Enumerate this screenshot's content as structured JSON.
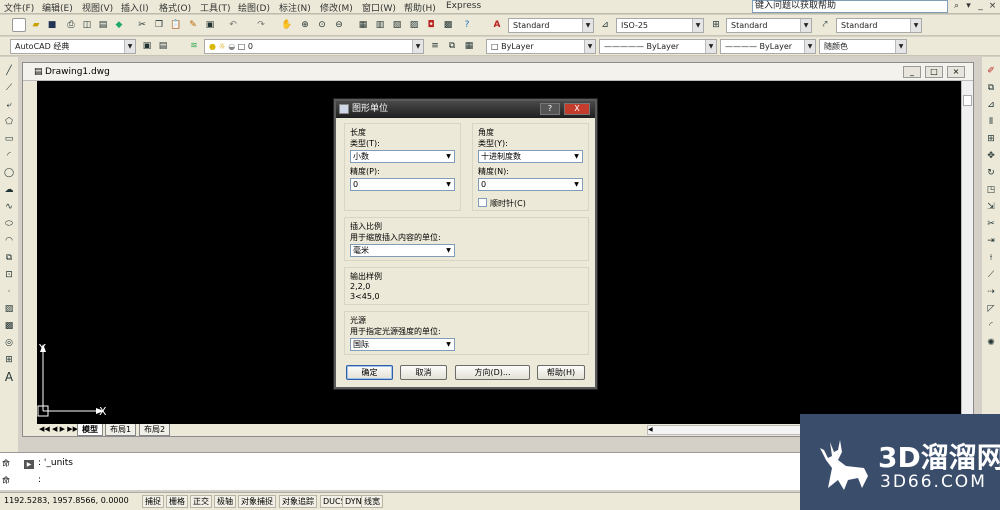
{
  "menu": {
    "items": [
      "文件(F)",
      "编辑(E)",
      "视图(V)",
      "插入(I)",
      "格式(O)",
      "工具(T)",
      "绘图(D)",
      "标注(N)",
      "修改(M)",
      "窗口(W)",
      "帮助(H)",
      "Express"
    ],
    "help_search_placeholder": "键入问题以获取帮助"
  },
  "toolbar": {
    "text_style": "Standard",
    "dim_style": "ISO-25",
    "table_style": "Standard",
    "multileader_style": "Standard",
    "workspace": "AutoCAD 经典",
    "layer": "0",
    "color": "ByLayer",
    "linetype": "ByLayer",
    "lineweight": "ByLayer",
    "plotstyle": "随颜色"
  },
  "drawing": {
    "title": "Drawing1.dwg",
    "ucs_x": "X",
    "ucs_y": "Y",
    "tabs": [
      "模型",
      "布局1",
      "布局2"
    ]
  },
  "dialog": {
    "title": "图形单位",
    "help_btn": "?",
    "close_btn": "X",
    "length": {
      "label": "长度",
      "type_label": "类型(T):",
      "type_value": "小数",
      "precision_label": "精度(P):",
      "precision_value": "0"
    },
    "angle": {
      "label": "角度",
      "type_label": "类型(Y):",
      "type_value": "十进制度数",
      "precision_label": "精度(N):",
      "precision_value": "0",
      "clockwise_label": "顺时针(C)"
    },
    "insertion": {
      "label": "插入比例",
      "desc": "用于缩放插入内容的单位:",
      "value": "毫米"
    },
    "sample": {
      "label": "输出样例",
      "line1": "2,2,0",
      "line2": "3<45,0"
    },
    "lighting": {
      "label": "光源",
      "desc": "用于指定光源强度的单位:",
      "value": "国际"
    },
    "buttons": {
      "ok": "确定",
      "cancel": "取消",
      "direction": "方向(D)...",
      "help": "帮助(H)"
    }
  },
  "command": {
    "side_label_1": "命",
    "side_label_2": "命",
    "line1": ": '_units",
    "line2": ":"
  },
  "status": {
    "coords": "1192.5283, 1957.8566, 0.0000",
    "buttons": [
      "捕捉",
      "栅格",
      "正交",
      "极轴",
      "对象捕捉",
      "对象追踪",
      "DUCS",
      "DYN",
      "线宽"
    ]
  },
  "watermark": {
    "brand": "3D溜溜网",
    "url": "3D66.COM"
  }
}
